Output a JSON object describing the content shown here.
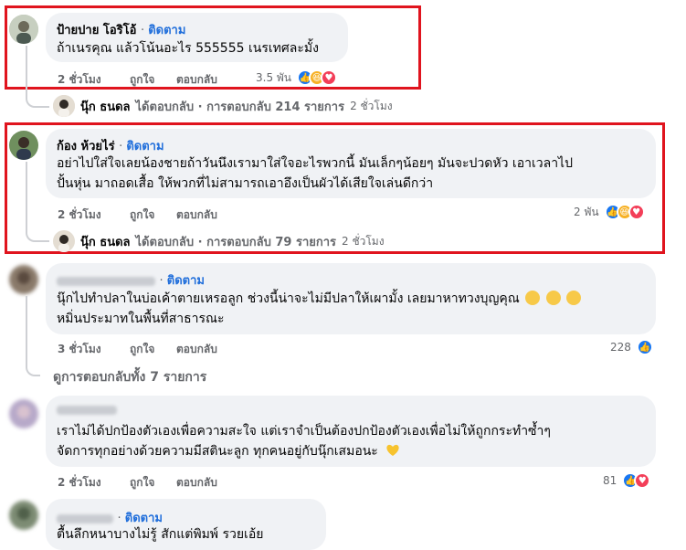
{
  "colors": {
    "accent": "#216fdb",
    "highlight": "#e0141e",
    "bubble": "#f0f2f5",
    "meta": "#65676b"
  },
  "comments": [
    {
      "author": "ป้ายปาย โอริโอ้",
      "follow": "ติดตาม",
      "lines": [
        "ถ้าเนรคุณ แล้วโน้นอะไร 555555 เนรเทศละมั้ง"
      ],
      "time": "2 ชั่วโมง",
      "like": "ถูกใจ",
      "reply": "ตอบกลับ",
      "reaction_count": "3.5 พัน",
      "reactions": [
        "like-icon",
        "haha-icon",
        "love-icon"
      ],
      "reply_summary": {
        "name": "นุ๊ก ธนดล",
        "text": "ได้ตอบกลับ · การตอบกลับ 214 รายการ",
        "time": "2 ชั่วโมง"
      }
    },
    {
      "author": "ก้อง ห้วยไร่",
      "follow": "ติดตาม",
      "lines": [
        "อย่าไปใส่ใจเลยน้องชายถ้าวันนึงเรามาใส่ใจอะไรพวกนี้ มันเล็กๆน้อยๆ มันจะปวดหัว เอาเวลาไป",
        "ปั้นหุ่น มาถอดเสื้อ ให้พวกที่ไม่สามารถเอาอึงเป็นผัวได้เสียใจเล่นดีกว่า"
      ],
      "time": "2 ชั่วโมง",
      "like": "ถูกใจ",
      "reply": "ตอบกลับ",
      "reaction_count": "2 พัน",
      "reactions": [
        "like-icon",
        "haha-icon",
        "love-icon"
      ],
      "reply_summary": {
        "name": "นุ๊ก ธนดล",
        "text": "ได้ตอบกลับ · การตอบกลับ 79 รายการ",
        "time": "2 ชั่วโมง"
      }
    },
    {
      "follow": "ติดตาม",
      "lines": [
        "นุ๊กไปทำปลาในบ่อเค้าตายเหรอลูก ช่วงนี้น่าจะไม่มีปลาให้เผามั้ง เลยมาหาทวงบุญคุณ",
        "หมิ่นประมาทในพื้นที่สาธารณะ"
      ],
      "time": "3 ชั่วโมง",
      "like": "ถูกใจ",
      "reply": "ตอบกลับ",
      "reaction_count": "228",
      "reactions": [
        "like-icon"
      ],
      "view_replies": "ดูการตอบกลับทั้ง 7 รายการ"
    },
    {
      "lines": [
        "เราไม่ได้ปกป้องตัวเองเพื่อความสะใจ แต่เราจำเป็นต้องปกป้องตัวเองเพื่อไม่ให้ถูกกระทำซ้ำๆ",
        "จัดการทุกอย่างด้วยความมีสตินะลูก ทุกคนอยู่กับนุ๊กเสมอนะ"
      ],
      "time": "2 ชั่วโมง",
      "like": "ถูกใจ",
      "reply": "ตอบกลับ",
      "reaction_count": "81",
      "reactions": [
        "like-icon",
        "love-icon"
      ]
    },
    {
      "follow": "ติดตาม",
      "lines": [
        "ตื้นลึกหนาบางไม่รู้ สักแต่พิมพ์ รวยเอ้ย"
      ]
    }
  ]
}
